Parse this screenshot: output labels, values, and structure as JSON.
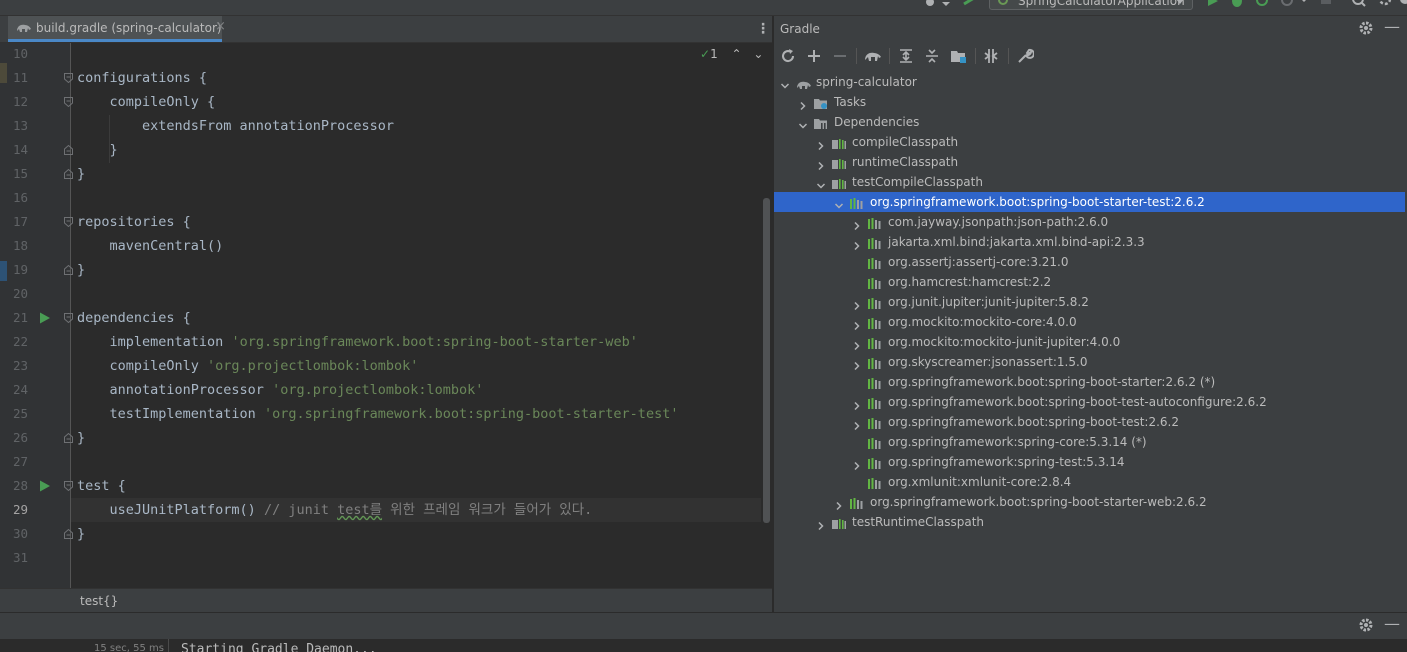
{
  "toolbar": {
    "run_config": "SpringCalculatorApplication"
  },
  "editor": {
    "tab_label": "build.gradle (spring-calculator)",
    "inspection_count": "1",
    "breadcrumb": "test{}",
    "lines": [
      {
        "n": "10",
        "code": []
      },
      {
        "n": "11",
        "code": [
          [
            "configurations {",
            ""
          ]
        ]
      },
      {
        "n": "12",
        "code": [
          [
            "    compileOnly {",
            ""
          ]
        ]
      },
      {
        "n": "13",
        "code": [
          [
            "        extendsFrom annotationProcessor",
            ""
          ]
        ]
      },
      {
        "n": "14",
        "code": [
          [
            "    }",
            ""
          ]
        ]
      },
      {
        "n": "15",
        "code": [
          [
            "}",
            ""
          ]
        ]
      },
      {
        "n": "16",
        "code": []
      },
      {
        "n": "17",
        "code": [
          [
            "repositories {",
            ""
          ]
        ]
      },
      {
        "n": "18",
        "code": [
          [
            "    mavenCentral()",
            ""
          ]
        ]
      },
      {
        "n": "19",
        "code": [
          [
            "}",
            ""
          ]
        ]
      },
      {
        "n": "20",
        "code": []
      },
      {
        "n": "21",
        "code": [
          [
            "dependencies {",
            ""
          ]
        ]
      },
      {
        "n": "22",
        "code": [
          [
            "    implementation ",
            ""
          ],
          [
            "'org.springframework.boot:spring-boot-starter-web'",
            "str"
          ]
        ]
      },
      {
        "n": "23",
        "code": [
          [
            "    compileOnly ",
            ""
          ],
          [
            "'org.projectlombok:lombok'",
            "str"
          ]
        ]
      },
      {
        "n": "24",
        "code": [
          [
            "    annotationProcessor ",
            ""
          ],
          [
            "'org.projectlombok:lombok'",
            "str"
          ]
        ]
      },
      {
        "n": "25",
        "code": [
          [
            "    testImplementation ",
            ""
          ],
          [
            "'org.springframework.boot:spring-boot-starter-test'",
            "str"
          ]
        ]
      },
      {
        "n": "26",
        "code": [
          [
            "}",
            ""
          ]
        ]
      },
      {
        "n": "27",
        "code": []
      },
      {
        "n": "28",
        "code": [
          [
            "test {",
            ""
          ]
        ]
      },
      {
        "n": "29",
        "code": [
          [
            "    useJUnitPlatform() ",
            ""
          ],
          [
            "// junit ",
            "cmt"
          ],
          [
            "test를",
            "cmt squig"
          ],
          [
            " 위한 프레임 워크가 들어가 있다.",
            "cmt"
          ]
        ]
      },
      {
        "n": "30",
        "code": [
          [
            "}",
            ""
          ]
        ]
      },
      {
        "n": "31",
        "code": []
      }
    ]
  },
  "gradle": {
    "title": "Gradle",
    "tree": [
      {
        "label": "spring-calculator",
        "depth": 0,
        "exp": "open",
        "icon": "gradle-project-icon"
      },
      {
        "label": "Tasks",
        "depth": 1,
        "exp": "closed",
        "icon": "tasks-folder-icon"
      },
      {
        "label": "Dependencies",
        "depth": 1,
        "exp": "open",
        "icon": "dependencies-folder-icon"
      },
      {
        "label": "compileClasspath",
        "depth": 2,
        "exp": "closed",
        "icon": "configuration-icon"
      },
      {
        "label": "runtimeClasspath",
        "depth": 2,
        "exp": "closed",
        "icon": "configuration-icon"
      },
      {
        "label": "testCompileClasspath",
        "depth": 2,
        "exp": "open",
        "icon": "configuration-icon"
      },
      {
        "label": "org.springframework.boot:spring-boot-starter-test:2.6.2",
        "depth": 3,
        "exp": "open",
        "icon": "library-icon",
        "selected": true
      },
      {
        "label": "com.jayway.jsonpath:json-path:2.6.0",
        "depth": 4,
        "exp": "closed",
        "icon": "library-icon"
      },
      {
        "label": "jakarta.xml.bind:jakarta.xml.bind-api:2.3.3",
        "depth": 4,
        "exp": "closed",
        "icon": "library-icon"
      },
      {
        "label": "org.assertj:assertj-core:3.21.0",
        "depth": 4,
        "exp": "none",
        "icon": "library-icon"
      },
      {
        "label": "org.hamcrest:hamcrest:2.2",
        "depth": 4,
        "exp": "none",
        "icon": "library-icon"
      },
      {
        "label": "org.junit.jupiter:junit-jupiter:5.8.2",
        "depth": 4,
        "exp": "closed",
        "icon": "library-icon"
      },
      {
        "label": "org.mockito:mockito-core:4.0.0",
        "depth": 4,
        "exp": "closed",
        "icon": "library-icon"
      },
      {
        "label": "org.mockito:mockito-junit-jupiter:4.0.0",
        "depth": 4,
        "exp": "closed",
        "icon": "library-icon"
      },
      {
        "label": "org.skyscreamer:jsonassert:1.5.0",
        "depth": 4,
        "exp": "closed",
        "icon": "library-icon"
      },
      {
        "label": "org.springframework.boot:spring-boot-starter:2.6.2 (*)",
        "depth": 4,
        "exp": "none",
        "icon": "library-icon"
      },
      {
        "label": "org.springframework.boot:spring-boot-test-autoconfigure:2.6.2",
        "depth": 4,
        "exp": "closed",
        "icon": "library-icon"
      },
      {
        "label": "org.springframework.boot:spring-boot-test:2.6.2",
        "depth": 4,
        "exp": "closed",
        "icon": "library-icon"
      },
      {
        "label": "org.springframework:spring-core:5.3.14 (*)",
        "depth": 4,
        "exp": "none",
        "icon": "library-icon"
      },
      {
        "label": "org.springframework:spring-test:5.3.14",
        "depth": 4,
        "exp": "closed",
        "icon": "library-icon"
      },
      {
        "label": "org.xmlunit:xmlunit-core:2.8.4",
        "depth": 4,
        "exp": "none",
        "icon": "library-icon"
      },
      {
        "label": "org.springframework.boot:spring-boot-starter-web:2.6.2",
        "depth": 3,
        "exp": "closed",
        "icon": "library-icon"
      },
      {
        "label": "testRuntimeClasspath",
        "depth": 2,
        "exp": "closed",
        "icon": "configuration-icon"
      }
    ]
  },
  "console": {
    "duration": "15 sec, 55 ms",
    "text": "Starting Gradle Daemon..."
  },
  "colors": {
    "selection": "#2f65ca",
    "string": "#6a8759",
    "comment": "#808080",
    "code": "#a9b7c6",
    "run_green": "#499c54"
  }
}
